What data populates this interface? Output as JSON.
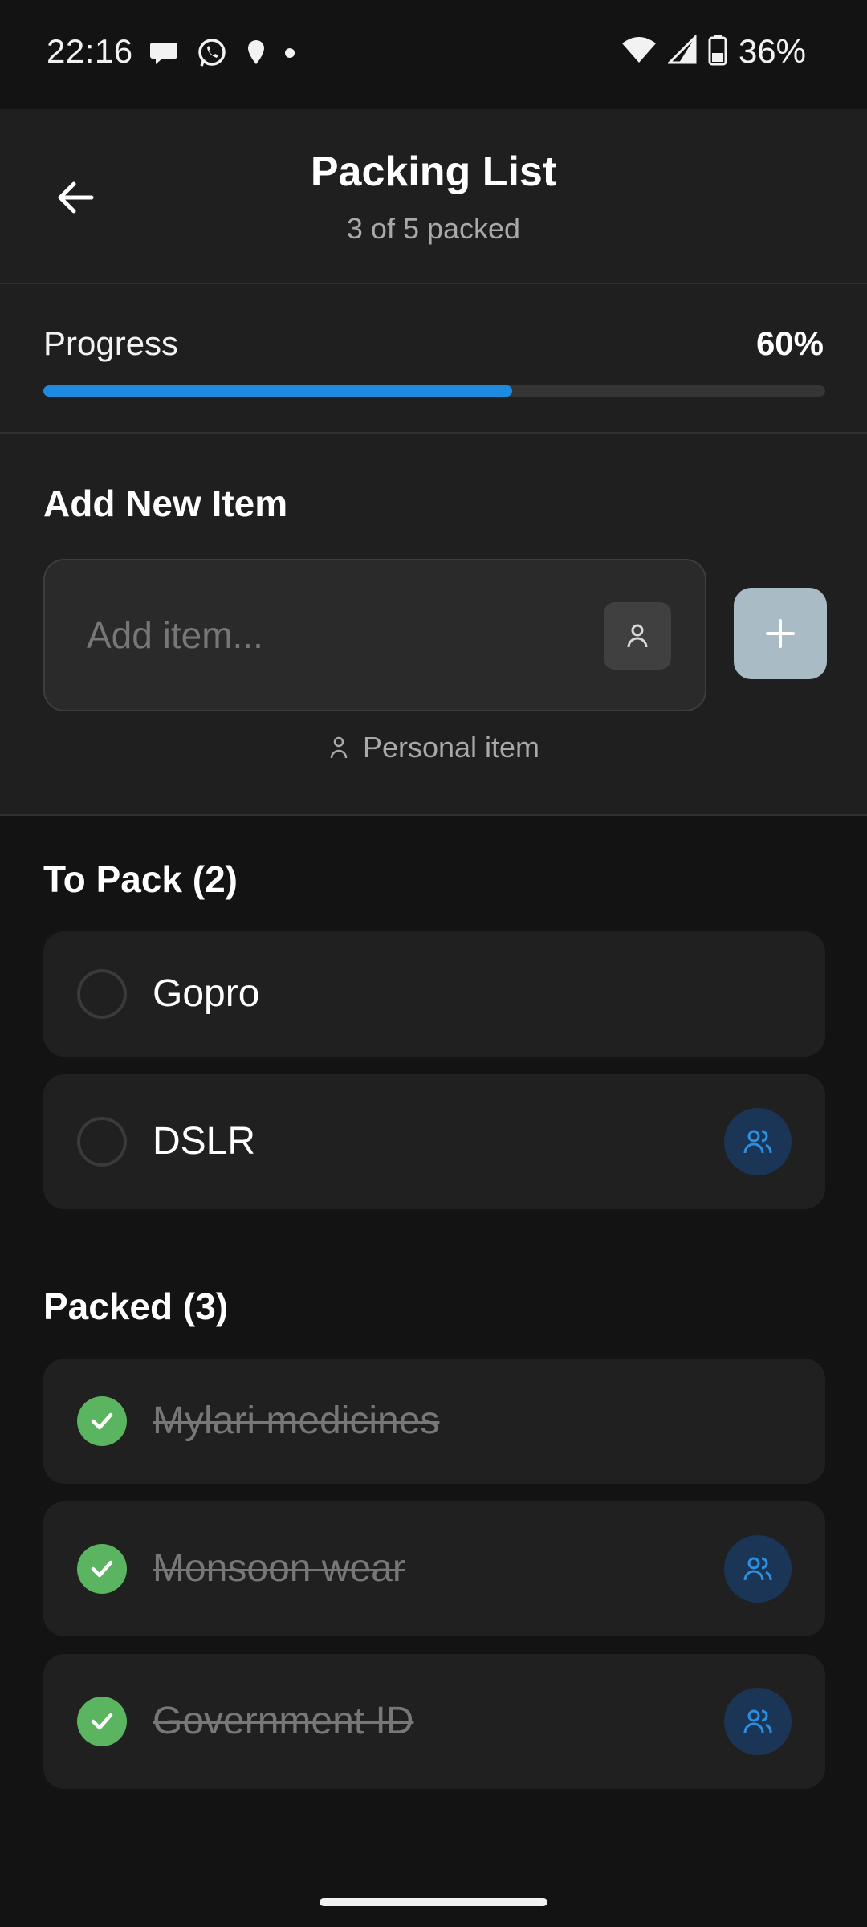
{
  "status_bar": {
    "time": "22:16",
    "battery": "36%",
    "icons": [
      "chat-bubble-icon",
      "whatsapp-icon",
      "location-icon",
      "dot-icon",
      "wifi-icon",
      "signal-icon",
      "battery-icon"
    ]
  },
  "header": {
    "title": "Packing List",
    "subtitle": "3 of 5 packed"
  },
  "progress": {
    "label": "Progress",
    "value_text": "60%",
    "fraction": 0.6,
    "fill_color": "#1d8ce0"
  },
  "add_item": {
    "heading": "Add New Item",
    "placeholder": "Add item...",
    "value": "",
    "hint": "Personal item",
    "button_color": "#a9bcc5"
  },
  "to_pack": {
    "heading": "To Pack (2)",
    "items": [
      {
        "label": "Gopro",
        "shared": false
      },
      {
        "label": "DSLR",
        "shared": true
      }
    ]
  },
  "packed": {
    "heading": "Packed (3)",
    "items": [
      {
        "label": "Mylari medicines",
        "shared": false
      },
      {
        "label": "Monsoon wear",
        "shared": true
      },
      {
        "label": "Government ID",
        "shared": true
      }
    ]
  },
  "colors": {
    "check_green": "#5bb560",
    "shared_badge_bg": "#1b3557",
    "shared_icon": "#2d8fe0"
  }
}
